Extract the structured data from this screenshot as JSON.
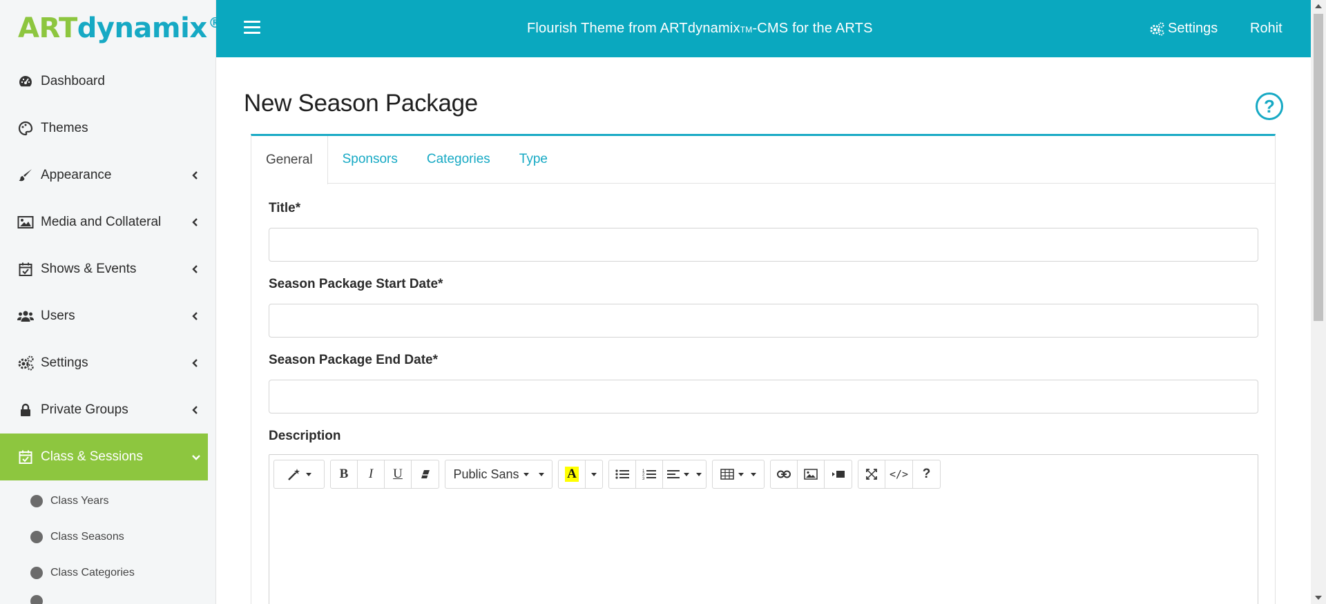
{
  "brand": {
    "part1": "ART",
    "part2": "dynamix",
    "reg": "®"
  },
  "topbar": {
    "title_main": "Flourish Theme from ARTdynamix",
    "title_tm": "TM",
    "title_rest": "-CMS for the ARTS",
    "settings_label": "Settings",
    "user_label": "Rohit"
  },
  "sidebar": {
    "items": [
      {
        "label": "Dashboard",
        "icon": "tachometer-icon"
      },
      {
        "label": "Themes",
        "icon": "palette-icon"
      },
      {
        "label": "Appearance",
        "icon": "paintbrush-icon"
      },
      {
        "label": "Media and Collateral",
        "icon": "image-icon"
      },
      {
        "label": "Shows & Events",
        "icon": "calendar-check-icon"
      },
      {
        "label": "Users",
        "icon": "users-icon"
      },
      {
        "label": "Settings",
        "icon": "gears-icon"
      },
      {
        "label": "Private Groups",
        "icon": "lock-icon"
      },
      {
        "label": "Class & Sessions",
        "icon": "calendar-check-icon"
      }
    ],
    "sub_items": [
      "Class Years",
      "Class Seasons",
      "Class Categories"
    ]
  },
  "page": {
    "title": "New Season Package",
    "tabs": [
      "General",
      "Sponsors",
      "Categories",
      "Type"
    ],
    "fields": {
      "title_label": "Title*",
      "start_label": "Season Package Start Date*",
      "end_label": "Season Package End Date*",
      "description_label": "Description"
    },
    "editor": {
      "font_name": "Public Sans"
    }
  },
  "colors": {
    "accent": "#0aa8bf",
    "active_green": "#8dc63f"
  }
}
